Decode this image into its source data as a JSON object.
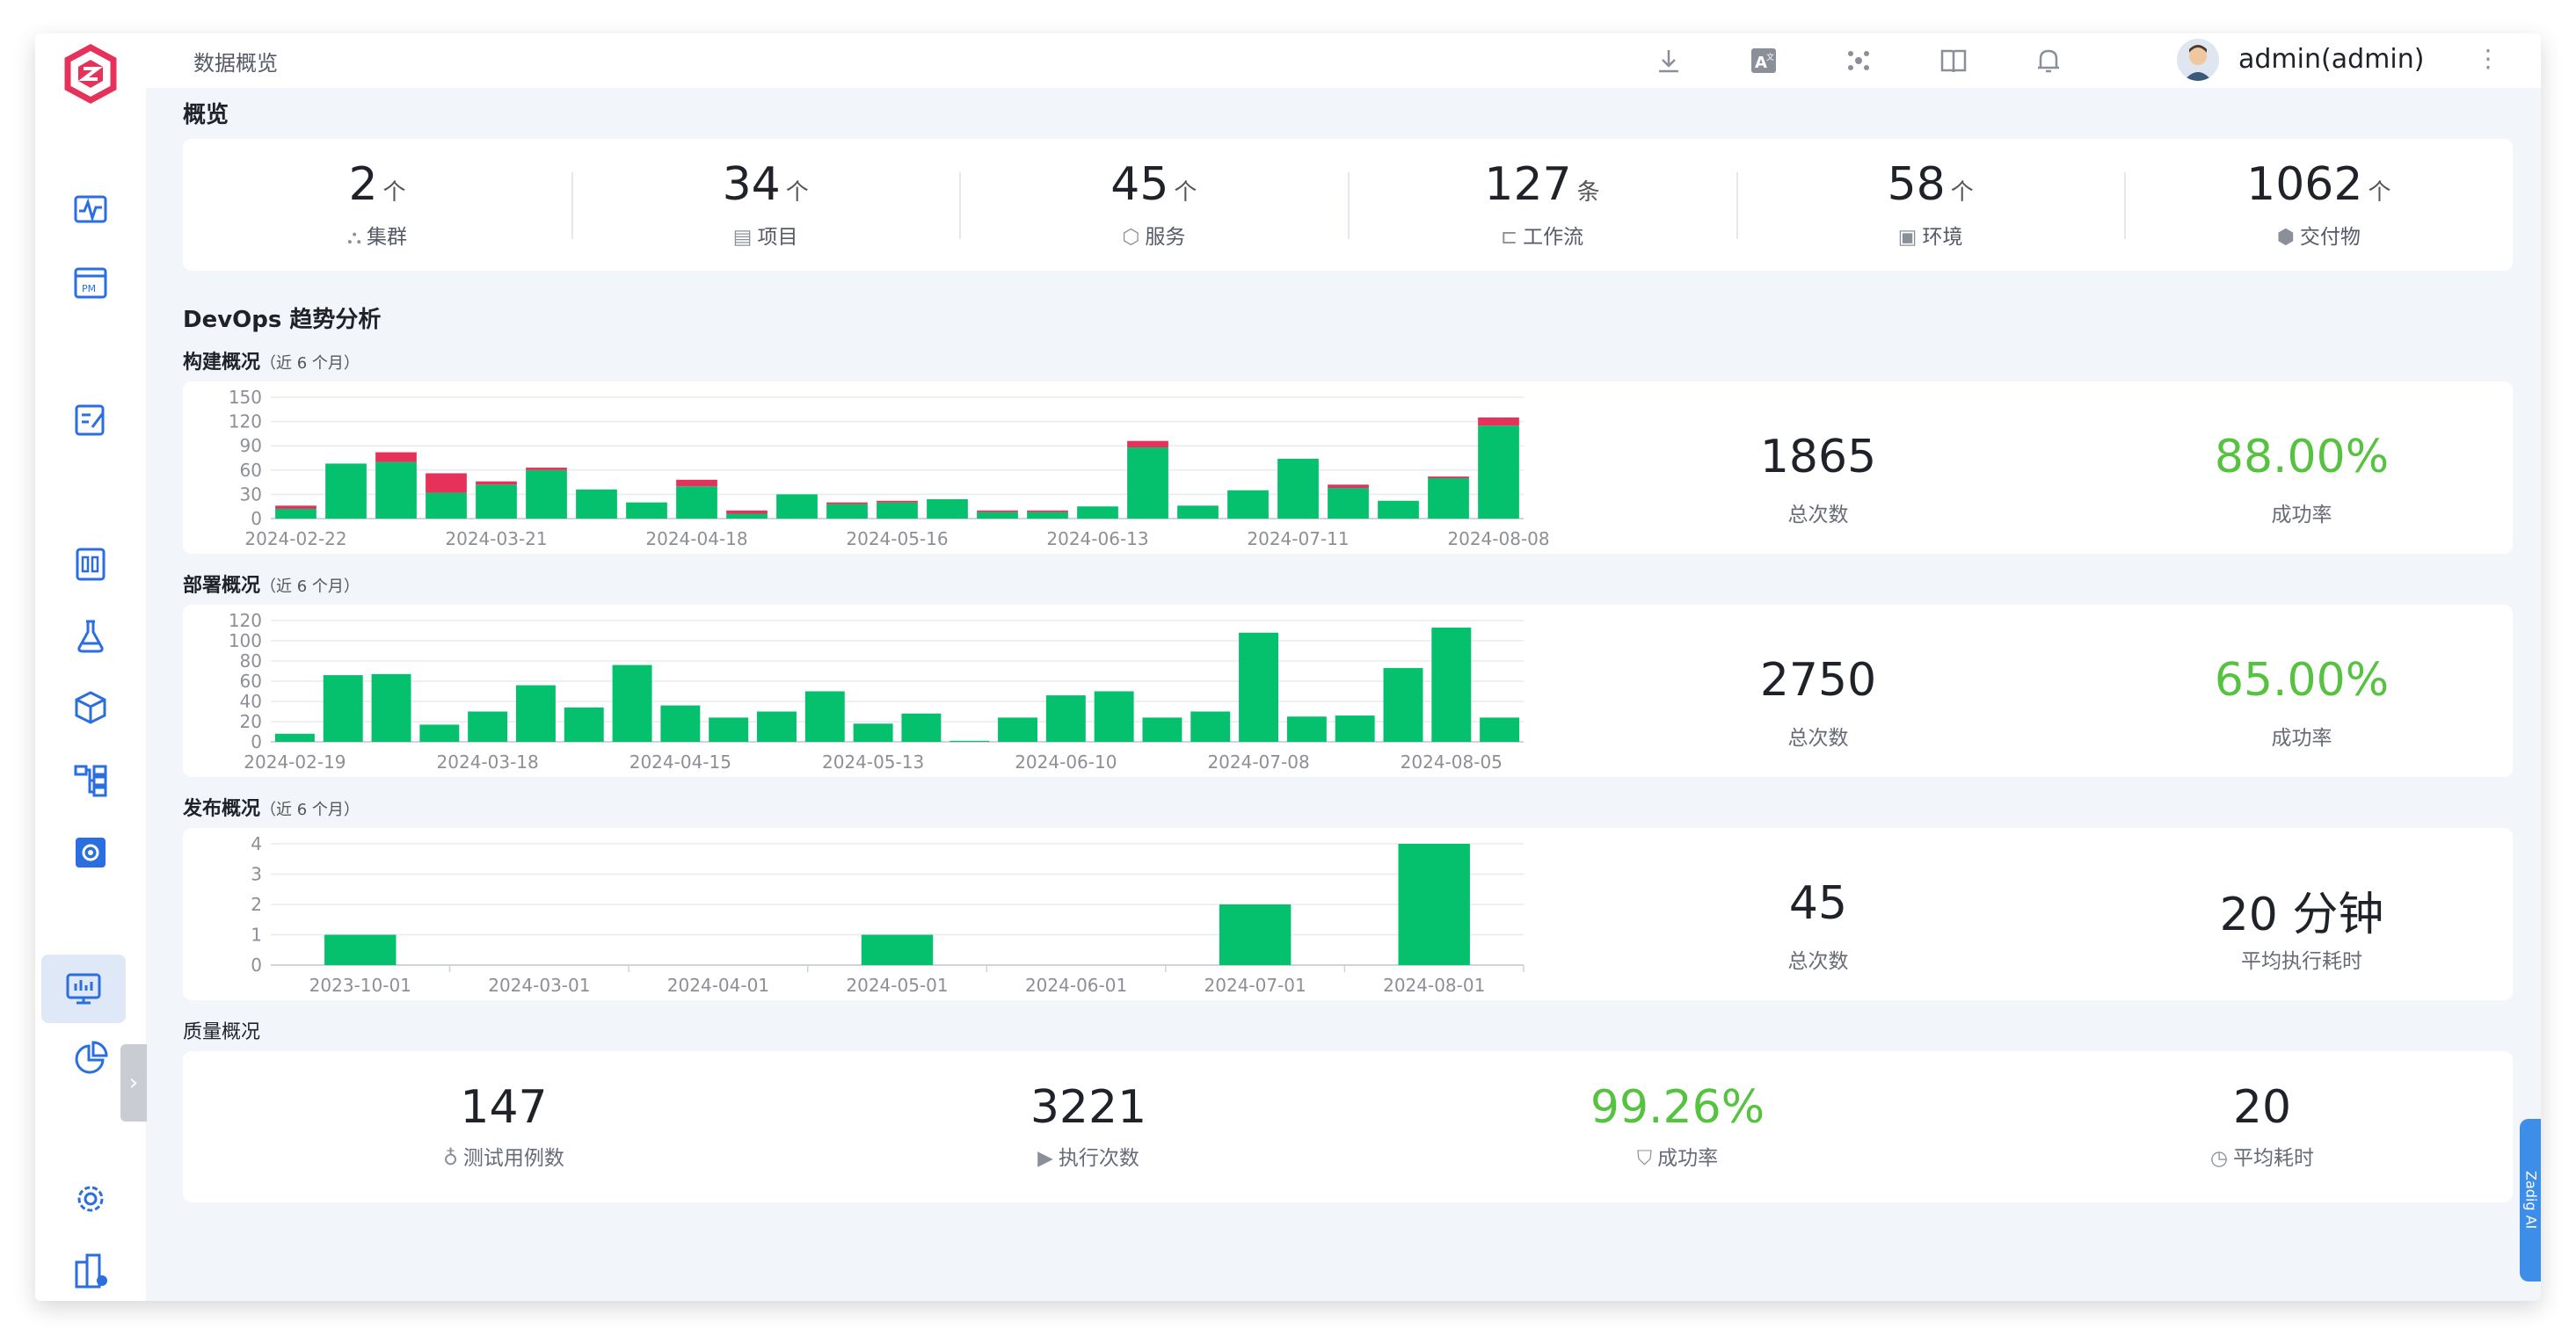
{
  "topbar": {
    "title": "数据概览",
    "username": "admin(admin)",
    "icons": [
      "download-icon",
      "translate-icon",
      "apps-icon",
      "docs-icon",
      "bell-icon"
    ]
  },
  "sidebar": {
    "icons": [
      "activity-icon",
      "pm-icon",
      "edit-icon",
      "report-icon",
      "flask-icon",
      "package-icon",
      "workflow-icon",
      "settings-box-icon",
      "monitor-icon",
      "pie-icon",
      "gear-icon",
      "building-icon"
    ],
    "collapse": "›"
  },
  "overview": {
    "title": "概览",
    "stats": [
      {
        "value": "2",
        "unit": "个",
        "label": "集群",
        "icon": "cluster-icon"
      },
      {
        "value": "34",
        "unit": "个",
        "label": "项目",
        "icon": "project-icon"
      },
      {
        "value": "45",
        "unit": "个",
        "label": "服务",
        "icon": "service-icon"
      },
      {
        "value": "127",
        "unit": "条",
        "label": "工作流",
        "icon": "workflow-icon"
      },
      {
        "value": "58",
        "unit": "个",
        "label": "环境",
        "icon": "env-icon"
      },
      {
        "value": "1062",
        "unit": "个",
        "label": "交付物",
        "icon": "artifact-icon"
      }
    ]
  },
  "devops": {
    "title": "DevOps 趋势分析",
    "build": {
      "title": "构建概况",
      "period": "（近 6 个月）",
      "total": "1865",
      "total_label": "总次数",
      "rate": "88.00%",
      "rate_label": "成功率"
    },
    "deploy": {
      "title": "部署概况",
      "period": "（近 6 个月）",
      "total": "2750",
      "total_label": "总次数",
      "rate": "65.00%",
      "rate_label": "成功率"
    },
    "release": {
      "title": "发布概况",
      "period": "（近 6 个月）",
      "total": "45",
      "total_label": "总次数",
      "avg": "20 分钟",
      "avg_label": "平均执行耗时"
    }
  },
  "quality": {
    "title": "质量概况",
    "stats": [
      {
        "value": "147",
        "label": "测试用例数",
        "icon": "testcase-icon"
      },
      {
        "value": "3221",
        "label": "执行次数",
        "icon": "play-icon"
      },
      {
        "value": "99.26%",
        "label": "成功率",
        "icon": "shield-icon"
      },
      {
        "value": "20",
        "label": "平均耗时",
        "icon": "clock-icon"
      }
    ]
  },
  "zadig_ai": "Zadig AI",
  "colors": {
    "success": "#05c16e",
    "fail": "#e6325a",
    "green_text": "#55c33f"
  },
  "chart_data": [
    {
      "type": "bar",
      "title": "构建概况",
      "stacked": true,
      "ylim": [
        0,
        150
      ],
      "yticks": [
        0,
        30,
        60,
        90,
        120,
        150
      ],
      "xtick_labels": [
        "2024-02-22",
        "2024-03-21",
        "2024-04-18",
        "2024-05-16",
        "2024-06-13",
        "2024-07-11",
        "2024-08-08"
      ],
      "xtick_index": [
        0,
        4,
        8,
        12,
        16,
        20,
        24
      ],
      "series": [
        {
          "color": "#05c16e",
          "values": [
            12,
            68,
            70,
            32,
            42,
            60,
            36,
            20,
            40,
            6,
            30,
            18,
            20,
            24,
            8,
            8,
            15,
            88,
            16,
            35,
            74,
            38,
            22,
            50,
            115
          ]
        },
        {
          "color": "#e6325a",
          "values": [
            4,
            0,
            12,
            24,
            4,
            3,
            0,
            0,
            8,
            4,
            0,
            2,
            2,
            0,
            2,
            2,
            0,
            8,
            0,
            0,
            0,
            4,
            0,
            2,
            10
          ]
        }
      ]
    },
    {
      "type": "bar",
      "title": "部署概况",
      "ylim": [
        0,
        120
      ],
      "yticks": [
        0,
        20,
        40,
        60,
        80,
        100,
        120
      ],
      "xtick_labels": [
        "2024-02-19",
        "2024-03-18",
        "2024-04-15",
        "2024-05-13",
        "2024-06-10",
        "2024-07-08",
        "2024-08-05"
      ],
      "xtick_index": [
        0,
        4,
        8,
        12,
        16,
        20,
        24
      ],
      "series": [
        {
          "color": "#05c16e",
          "values": [
            8,
            66,
            67,
            17,
            30,
            56,
            34,
            76,
            36,
            24,
            30,
            50,
            18,
            28,
            1,
            24,
            46,
            50,
            24,
            30,
            108,
            25,
            26,
            73,
            113,
            24
          ]
        }
      ]
    },
    {
      "type": "bar",
      "title": "发布概况",
      "ylim": [
        0,
        4
      ],
      "yticks": [
        0,
        1,
        2,
        3,
        4
      ],
      "categories": [
        "2023-10-01",
        "2024-03-01",
        "2024-04-01",
        "2024-05-01",
        "2024-06-01",
        "2024-07-01",
        "2024-08-01"
      ],
      "series": [
        {
          "color": "#05c16e",
          "values": [
            1,
            0,
            0,
            1,
            0,
            2,
            4
          ]
        }
      ]
    }
  ]
}
